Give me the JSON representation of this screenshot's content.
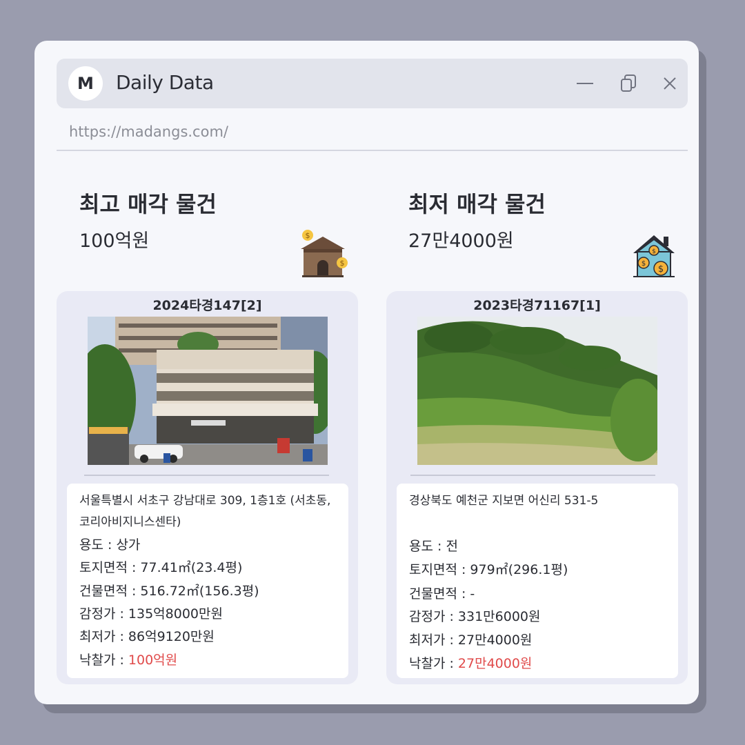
{
  "window": {
    "avatar_letter": "M",
    "title": "Daily Data",
    "url": "https://madangs.com/",
    "controls": [
      "minimize-icon",
      "restore-icon",
      "close-icon"
    ]
  },
  "left": {
    "heading": "최고 매각 물건",
    "price": "100억원",
    "icon": "building-money-icon",
    "case_no": "2024타경147[2]",
    "photo": "commercial-building-photo",
    "address": "서울특별시 서초구 강남대로 309, 1층1호 (서초동,코리아비지니스센타)",
    "rows": [
      {
        "label": "용도 : ",
        "value": "상가"
      },
      {
        "label": "토지면적 : ",
        "value": "77.41㎡(23.4평)"
      },
      {
        "label": "건물면적 : ",
        "value": "516.72㎡(156.3평)"
      },
      {
        "label": "감정가 : ",
        "value": "135억8000만원"
      },
      {
        "label": "최저가 : ",
        "value": "86억9120만원"
      },
      {
        "label": "낙찰가 : ",
        "value": "100억원"
      }
    ]
  },
  "right": {
    "heading": "최저 매각 물건",
    "price": "27만4000원",
    "icon": "house-money-icon",
    "case_no": "2023타경71167[1]",
    "photo": "farmland-hill-photo",
    "address": "경상북도 예천군 지보면 어신리 531-5",
    "rows": [
      {
        "label": "용도 : ",
        "value": "전"
      },
      {
        "label": "토지면적 : ",
        "value": "979㎡(296.1평)"
      },
      {
        "label": "건물면적 : ",
        "value": "-"
      },
      {
        "label": "감정가 : ",
        "value": "331만6000원"
      },
      {
        "label": "최저가 : ",
        "value": "27만4000원"
      },
      {
        "label": "낙찰가 : ",
        "value": "27만4000원"
      }
    ]
  },
  "colors": {
    "accent_red": "#e04a4a",
    "background": "#9a9cae",
    "window": "#f6f7fb"
  }
}
